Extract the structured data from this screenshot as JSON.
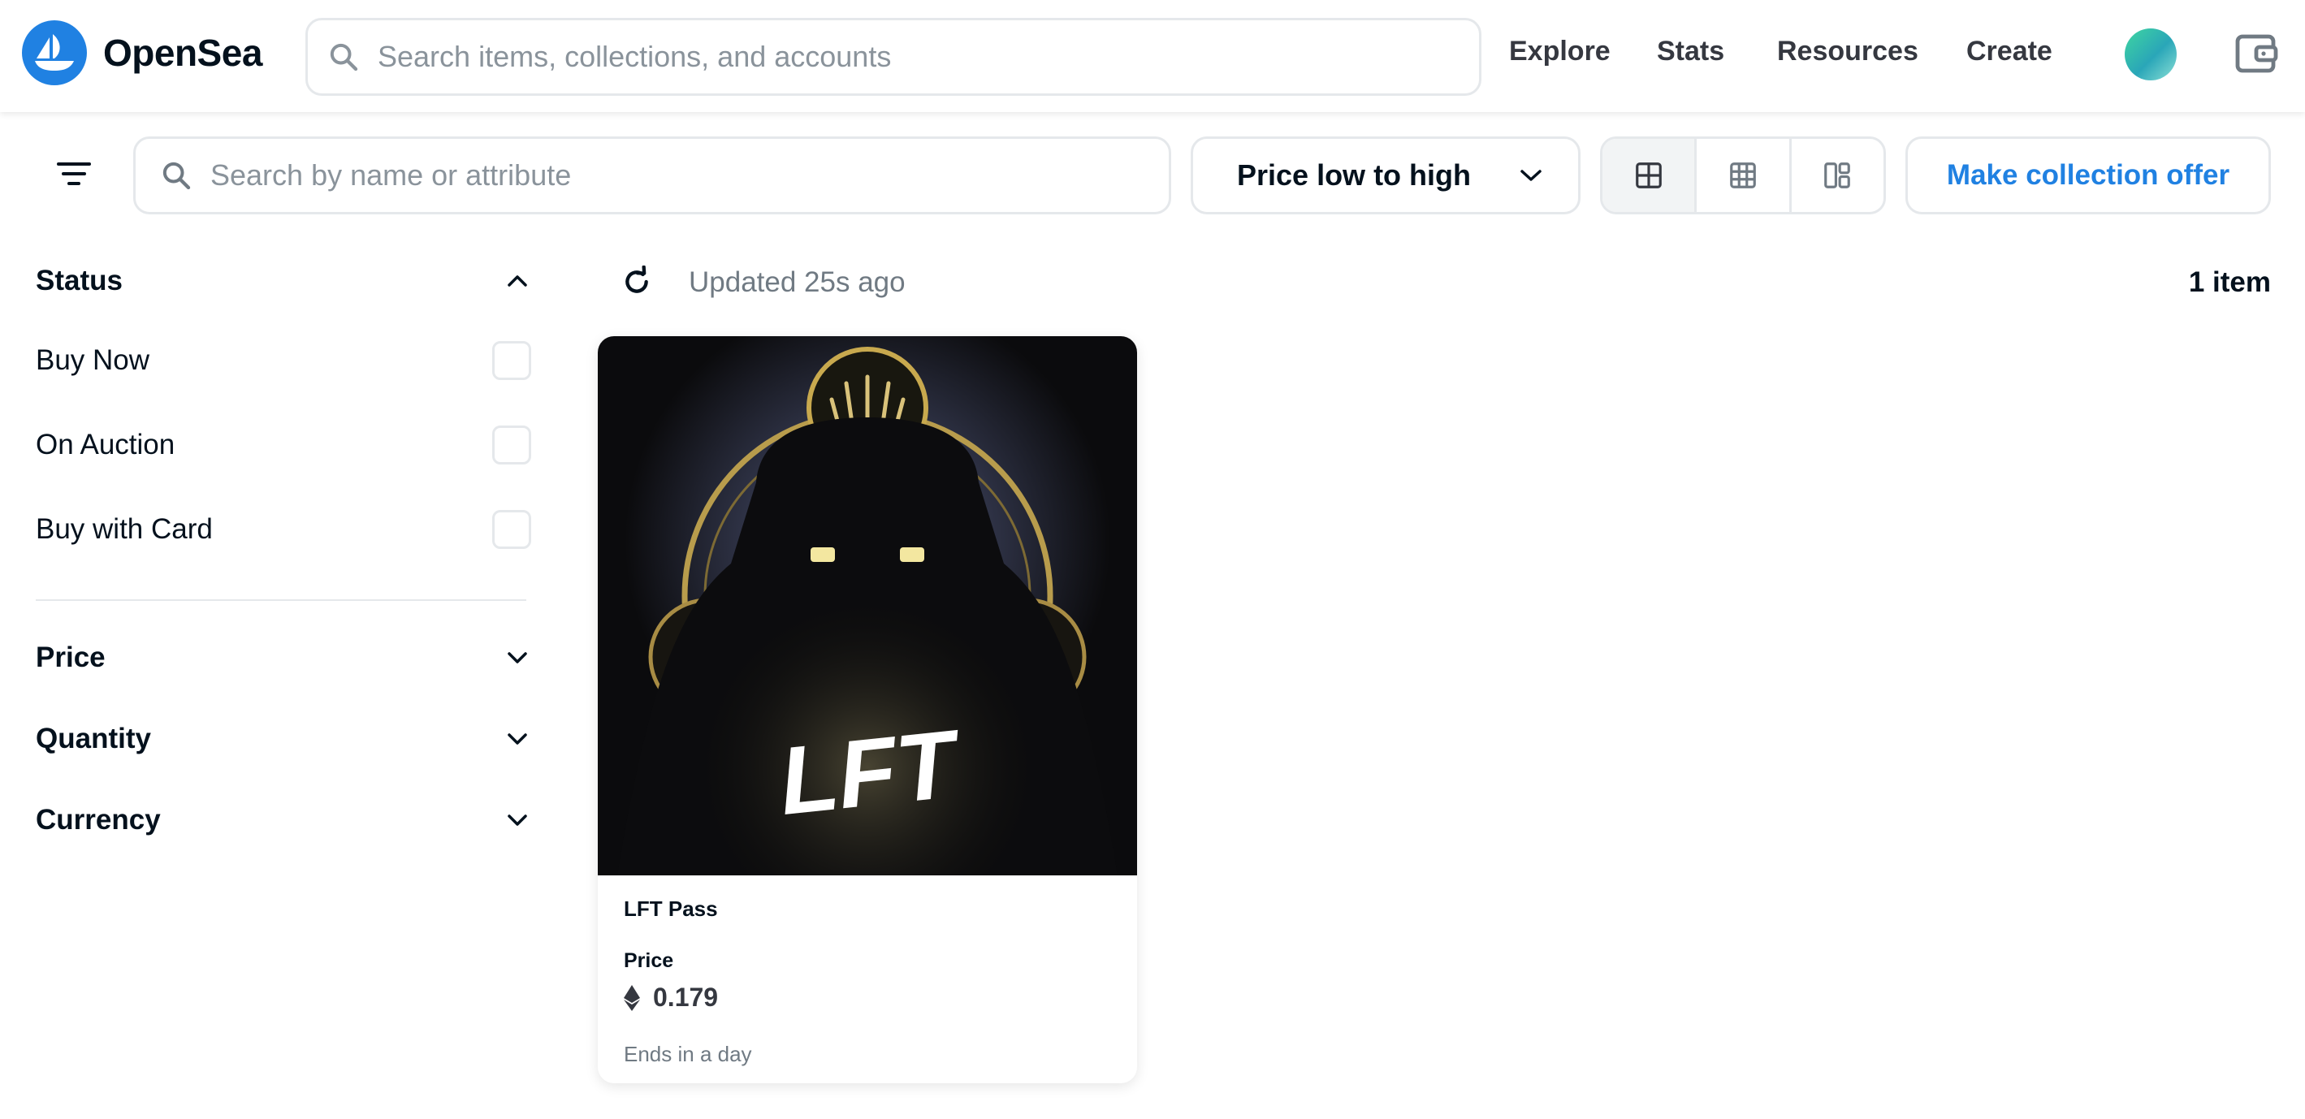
{
  "brand": {
    "name": "OpenSea",
    "accent": "#2081e2"
  },
  "header": {
    "search_placeholder": "Search items, collections, and accounts",
    "nav": [
      "Explore",
      "Stats",
      "Resources",
      "Create"
    ]
  },
  "toolbar": {
    "search_placeholder": "Search by name or attribute",
    "sort_label": "Price low to high",
    "views": [
      "large-grid-icon",
      "small-grid-icon",
      "mosaic-icon"
    ],
    "active_view": 0,
    "offer_label": "Make collection offer"
  },
  "sidebar": {
    "status": {
      "title": "Status",
      "options": [
        "Buy Now",
        "On Auction",
        "Buy with Card"
      ]
    },
    "sections": [
      "Price",
      "Quantity",
      "Currency"
    ]
  },
  "results": {
    "updated": "Updated 25s ago",
    "count": "1 item"
  },
  "item": {
    "name": "LFT Pass",
    "price_label": "Price",
    "price": "0.179",
    "currency_icon": "ethereum-icon",
    "ends": "Ends in a day",
    "image_text": "LFT"
  }
}
